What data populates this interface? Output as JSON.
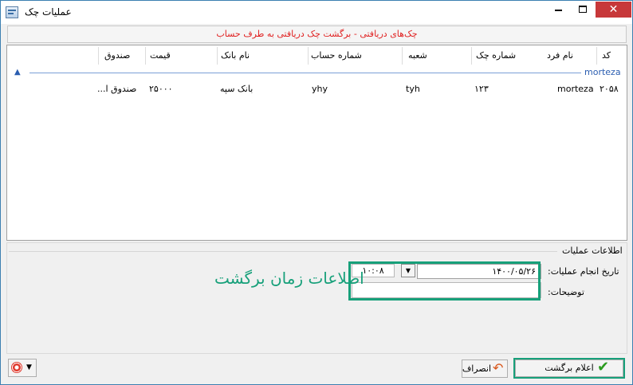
{
  "window": {
    "title": "عملیات چک"
  },
  "banner": {
    "text": "چک‌های دریافتی - برگشت چک دریافتی به طرف حساب"
  },
  "table": {
    "columns": {
      "code": "کد",
      "person": "نام فرد",
      "check_number": "شماره چک",
      "branch": "شعبه",
      "account_number": "شماره حساب",
      "bank_name": "نام بانک",
      "price": "قیمت",
      "fund": "صندوق"
    },
    "group": {
      "label": "morteza"
    },
    "row": {
      "code": "۲۰۵۸",
      "person": "morteza",
      "check_number": "۱۲۳",
      "branch": "tyh",
      "account_number": "yhy",
      "bank_name": "بانک سپه",
      "price": "۲۵۰۰۰",
      "fund": "صندوق ا..."
    }
  },
  "info": {
    "title": "اطلاعات عملیات",
    "date_label": "تاریخ انجام عملیات:",
    "date_value": "۱۴۰۰/۰۵/۲۶",
    "time_value": "۱۰:۰۸",
    "description_label": "توضیحات:",
    "annotation": "اطلاعات زمان برگشت"
  },
  "buttons": {
    "cancel": "انصراف",
    "confirm": "اعلام برگشت"
  },
  "colors": {
    "highlight": "#17a07a",
    "banner_text": "#e02020",
    "group_text": "#2a5db0",
    "close_button": "#c7383a"
  }
}
